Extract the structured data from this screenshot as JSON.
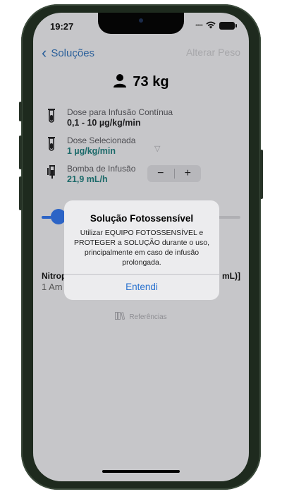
{
  "status_bar": {
    "time": "19:27"
  },
  "nav": {
    "back_label": "Soluções",
    "right_label": "Alterar Peso"
  },
  "patient": {
    "weight": "73 kg"
  },
  "rows": [
    {
      "label": "Dose para Infusão Contínua",
      "value": "0,1 - 10 µg/kg/min"
    },
    {
      "label": "Dose Selecionada",
      "value": "1 µg/kg/min"
    },
    {
      "label": "Bomba de Infusão",
      "value": "21,9 mL/h"
    }
  ],
  "stepper": {
    "minus": "−",
    "plus": "+"
  },
  "slider": {
    "fraction": 0.05
  },
  "background_text": {
    "line1_left": "Nitrop",
    "line1_right": "mL)]",
    "line2_left": "1 Am"
  },
  "references": {
    "label": "Referências"
  },
  "alert": {
    "title": "Solução Fotossensível",
    "message": "Utilizar EQUIPO FOTOSSENSÍVEL e PROTEGER a SOLUÇÃO durante o uso, principalmente em caso de infusão prolongada.",
    "button": "Entendi"
  },
  "colors": {
    "accent": "#2a72cf",
    "teal": "#1c6a6a",
    "slider": "#2c64c6",
    "overlay": "#c6c6c9"
  }
}
